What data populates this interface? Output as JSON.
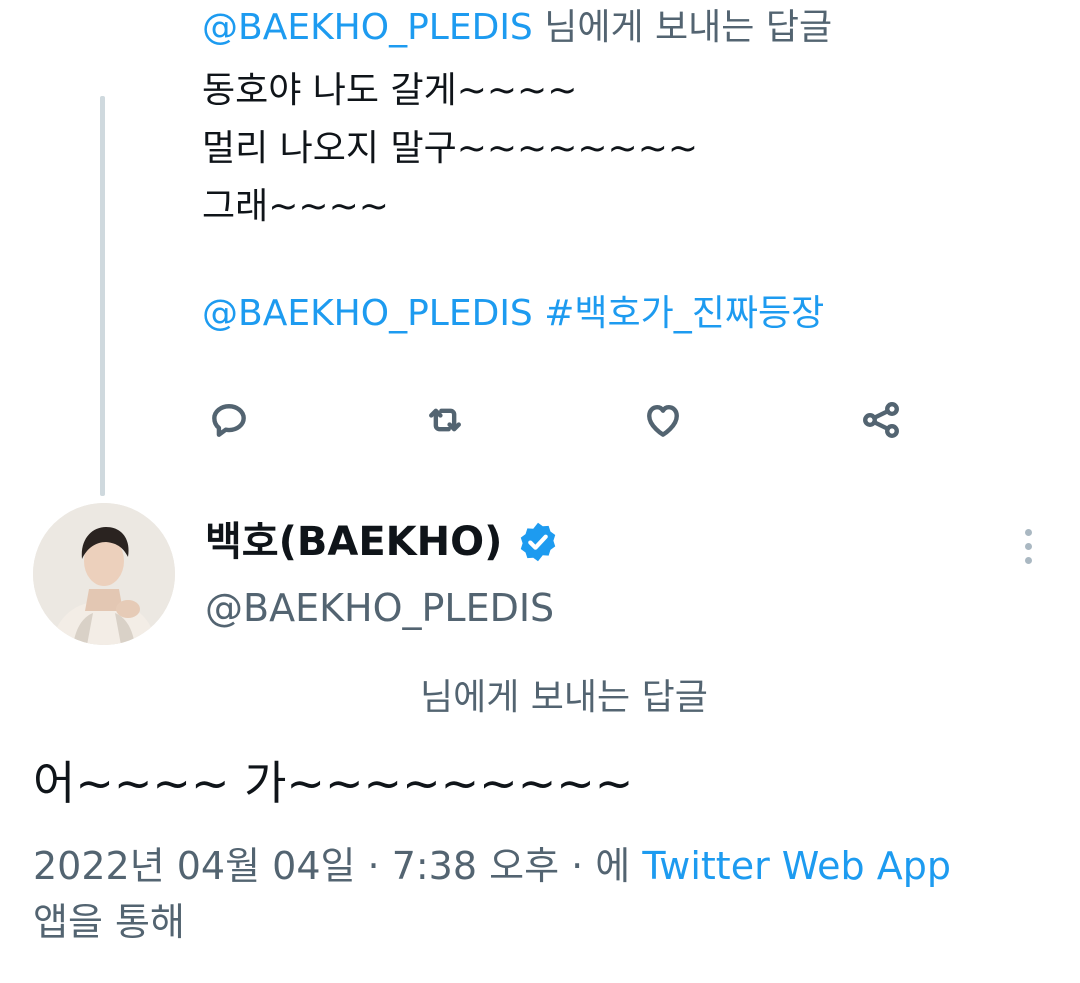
{
  "parent_tweet": {
    "reply_mention": "@BAEKHO_PLEDIS",
    "reply_suffix": " 님에게 보내는 답글",
    "lines": [
      "동호야 나도 갈게~~~~",
      "멀리 나오지 말구~~~~~~~~",
      "그래~~~~"
    ],
    "mention": "@BAEKHO_PLEDIS",
    "hashtag": "#백호가_진짜등장",
    "actions": [
      {
        "name": "reply",
        "icon": "reply-icon"
      },
      {
        "name": "retweet",
        "icon": "retweet-icon"
      },
      {
        "name": "like",
        "icon": "heart-icon"
      },
      {
        "name": "share",
        "icon": "share-icon"
      }
    ]
  },
  "main_tweet": {
    "display_name": "백호(BAEKHO)",
    "verified_icon": "verified-badge-icon",
    "handle": "@BAEKHO_PLEDIS",
    "reply_note": "님에게 보내는 답글",
    "text": "어~~~~ 가~~~~~~~~~",
    "date": "2022년 04월 04일",
    "separator": " · ",
    "time": "7:38 오후",
    "via_prefix": "에 ",
    "source": "Twitter Web App",
    "via_suffix": "앱을 통해"
  },
  "colors": {
    "link": "#1d9bf0",
    "secondary_text": "#536471",
    "primary_text": "#0f1419",
    "thread_line": "#cfd9de"
  }
}
